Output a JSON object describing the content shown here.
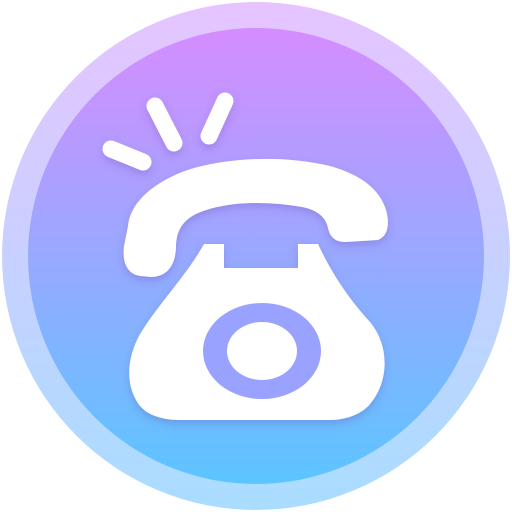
{
  "app_icon": {
    "name": "phone",
    "icon": "ringing-rotary-telephone-icon",
    "colors": {
      "gradient_top": "#d58cff",
      "gradient_bottom": "#5cc5ff",
      "ring_top": "#e6c4ff",
      "ring_bottom": "#a9ddff",
      "glyph": "#ffffff",
      "dial_center": "#9aa2ff"
    }
  }
}
